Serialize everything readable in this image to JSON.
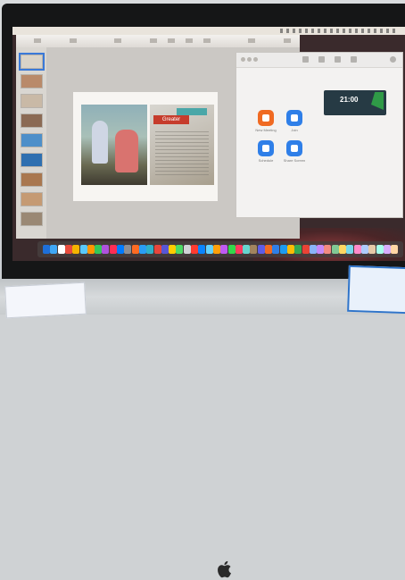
{
  "keynote": {
    "slide": {
      "clipping_headline": "Greater"
    }
  },
  "zoom": {
    "buttons": [
      {
        "name": "new-meeting",
        "label": "New Meeting",
        "color": "#f06a22"
      },
      {
        "name": "join",
        "label": "Join",
        "color": "#2f7fe8"
      },
      {
        "name": "schedule",
        "label": "Schedule",
        "color": "#2f7fe8"
      },
      {
        "name": "share-screen",
        "label": "Share Screen",
        "color": "#2f7fe8"
      }
    ],
    "clock": {
      "time": "21:00",
      "date": ""
    },
    "upcoming_text": ""
  },
  "dock": {
    "icons": [
      "#1e6fd9",
      "#3fa7f5",
      "#ffffff",
      "#e94b3c",
      "#f5b400",
      "#5ac8fa",
      "#ff9500",
      "#34c759",
      "#af52de",
      "#ff2d55",
      "#007aff",
      "#8e8e93",
      "#ff6b22",
      "#2a9df4",
      "#30b0c7",
      "#e8453c",
      "#5856d6",
      "#ffcc00",
      "#4cd964",
      "#d1d1d6",
      "#ff3b30",
      "#0a84ff",
      "#64d2ff",
      "#ff9f0a",
      "#bf5af2",
      "#32d74b",
      "#ff375f",
      "#66d4cf",
      "#a2845e",
      "#5e5ce6",
      "#f06a22",
      "#2f7fe8",
      "#1d9bf0",
      "#fbbc05",
      "#34a853",
      "#ea4335",
      "#8ab4f8",
      "#c58af9",
      "#f28b82",
      "#81c995",
      "#fdd663",
      "#78d9ec",
      "#ff8bcb",
      "#aecbfa",
      "#e6c9a8",
      "#a7ffeb",
      "#d7aefb",
      "#ffd6a5"
    ]
  },
  "colors": {
    "accent_blue": "#2f7fe8",
    "accent_orange": "#f06a22"
  }
}
